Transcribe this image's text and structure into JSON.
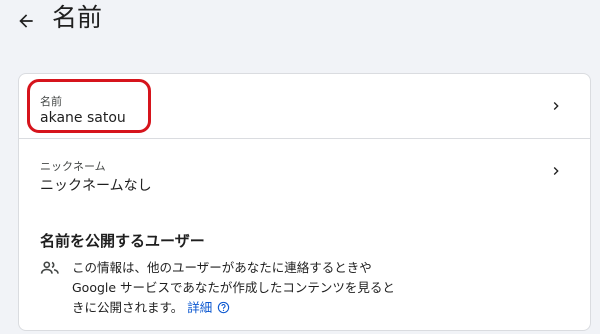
{
  "header": {
    "title": "名前"
  },
  "name_row": {
    "label": "名前",
    "value": "akane satou"
  },
  "nickname_row": {
    "label": "ニックネーム",
    "value": "ニックネームなし"
  },
  "visibility_section": {
    "heading": "名前を公開するユーザー",
    "description_line1": "この情報は、他のユーザーがあなたに連絡するときや",
    "description_line2": "Google サービスであなたが作成したコンテンツを見ると",
    "description_line3": "きに公開されます。",
    "link_label": "詳細"
  },
  "colors": {
    "page_background": "#f1f3f7",
    "card_background": "#ffffff",
    "highlight_annotation": "#d6141c",
    "link": "#0b57d0"
  },
  "icons": {
    "back": "arrow-left",
    "row_chevron": "chevron-right",
    "people": "people-group",
    "help": "question-circle"
  }
}
